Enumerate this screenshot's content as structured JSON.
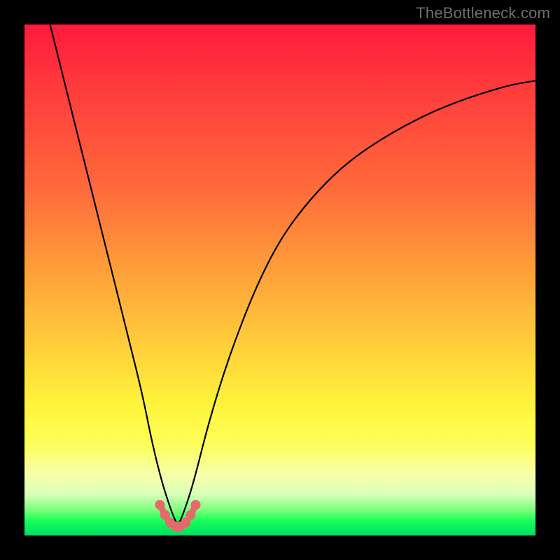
{
  "watermark": "TheBottleneck.com",
  "colors": {
    "frame": "#000000",
    "gradient_top": "#ff1a3c",
    "gradient_mid": "#ffd23a",
    "gradient_bottom": "#00e060",
    "curve": "#000000",
    "marker_fill": "#e46a6a",
    "marker_stroke": "#c24a4a"
  },
  "chart_data": {
    "type": "line",
    "title": "",
    "xlabel": "",
    "ylabel": "",
    "xlim": [
      0,
      100
    ],
    "ylim": [
      0,
      100
    ],
    "series": [
      {
        "name": "bottleneck-curve",
        "x": [
          5,
          8,
          11,
          14,
          17,
          20,
          23,
          25,
          27,
          29,
          30,
          31,
          33,
          36,
          40,
          45,
          50,
          56,
          63,
          72,
          82,
          94,
          100
        ],
        "y": [
          100,
          88,
          76,
          64,
          52,
          40,
          28,
          18,
          10,
          4,
          2,
          4,
          10,
          22,
          35,
          48,
          58,
          66,
          73,
          79,
          84,
          88,
          89
        ]
      }
    ],
    "markers": {
      "name": "valley-markers",
      "x": [
        26.5,
        27.5,
        28.5,
        29.5,
        30.0,
        30.5,
        31.5,
        32.5,
        33.5
      ],
      "y": [
        6.0,
        4.0,
        2.5,
        1.8,
        1.6,
        1.8,
        2.5,
        4.0,
        6.0
      ]
    },
    "valley_line": {
      "name": "valley-connector",
      "x": [
        26.5,
        27.5,
        28.5,
        29.5,
        30.0,
        30.5,
        31.5,
        32.5,
        33.5
      ],
      "y": [
        6.0,
        4.0,
        2.5,
        1.8,
        1.6,
        1.8,
        2.5,
        4.0,
        6.0
      ]
    }
  }
}
